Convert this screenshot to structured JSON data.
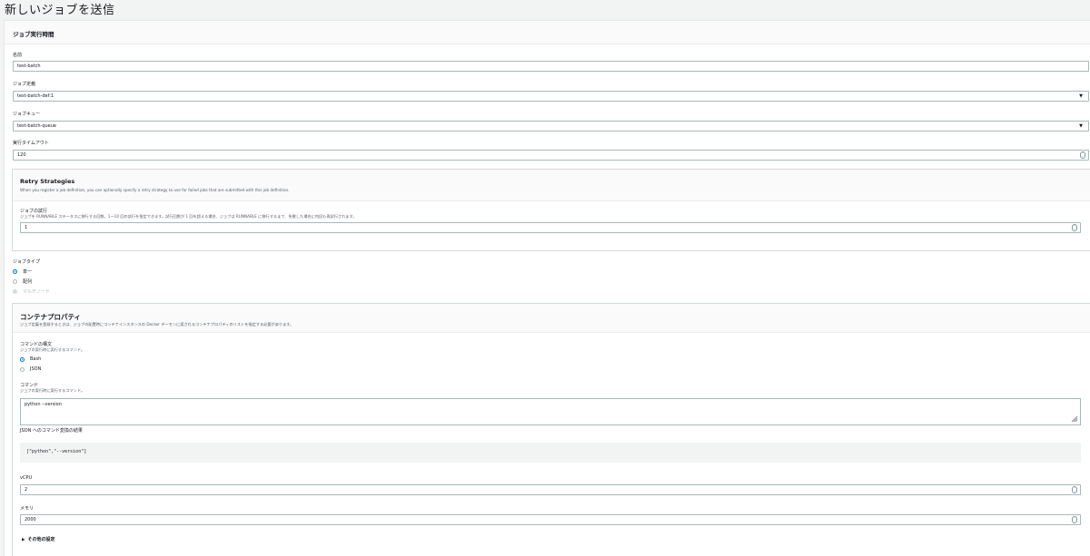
{
  "page": {
    "title": "新しいジョブを送信"
  },
  "job_runtime": {
    "heading": "ジョブ実行時間",
    "name_label": "名前",
    "name_value": "test-batch",
    "definition_label": "ジョブ定義",
    "definition_value": "test-batch-def:1",
    "queue_label": "ジョブキュー",
    "queue_value": "test-batch-queue",
    "timeout_label": "実行タイムアウト",
    "timeout_value": "120"
  },
  "retry": {
    "heading": "Retry Strategies",
    "description": "When you register a job definition, you can optionally specify a retry strategy to use for failed jobs that are submitted with this job definition.",
    "attempts_label": "ジョブの試行",
    "attempts_desc": "ジョブを RUNNABLE ステータスに移行する回数。1〜10 回の試行を指定できます。試行回数が 1 回を超える場合、ジョブは RUNNABLE に移行するまで、失敗した場合に何回も再試行されます。",
    "attempts_value": "1"
  },
  "job_type": {
    "label": "ジョブタイプ",
    "options": [
      "単一",
      "配列",
      "マルチノード"
    ],
    "selected": "単一"
  },
  "container": {
    "heading": "コンテナプロパティ",
    "description": "ジョブ定義を登録するときは、ジョブの配置時にコンテナインスタンスの Docker デーモンに渡されるコンテナプロパティのリストを指定する必要があります。",
    "syntax_label": "コマンドの構文",
    "syntax_desc": "ジョブの実行時に実行するコマンド。",
    "syntax_options": [
      "Bash",
      "JSON"
    ],
    "syntax_selected": "Bash",
    "command_label": "コマンド",
    "command_desc": "ジョブの実行時に実行するコマンド。",
    "command_value": "python --version",
    "json_result_label": "JSON へのコマンド変換の結果",
    "json_result_value": "[\"python\",\"--version\"]",
    "vcpu_label": "vCPU",
    "vcpu_value": "2",
    "memory_label": "メモリ",
    "memory_value": "2000",
    "other_settings": "その他の設定"
  },
  "icons": {
    "dropdown": "caret-down-icon",
    "spinner": "number-spinner-icon",
    "expand": "caret-right-icon",
    "resize": "resize-grip-icon"
  }
}
